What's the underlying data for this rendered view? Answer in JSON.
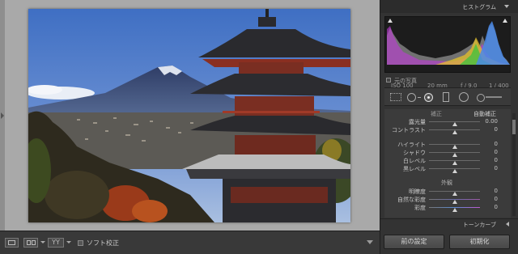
{
  "toolbar": {
    "view_glyph": "YY",
    "soft_proofing_label": "ソフト校正"
  },
  "right_panel": {
    "histogram": {
      "title": "ヒストグラム",
      "exif": {
        "iso": "ISO 100",
        "focal_length": "20 mm",
        "aperture": "f / 9.0",
        "shutter": "1 / 400"
      },
      "original_photo_label": "元の写真"
    },
    "basic": {
      "wb_label": "補正",
      "auto_tone_label": "自動補正",
      "tone_sliders": [
        {
          "label": "露光量",
          "value": "0.00",
          "position": 0.5
        },
        {
          "label": "コントラスト",
          "value": "0",
          "position": 0.5
        },
        {
          "label": "ハイライト",
          "value": "0",
          "position": 0.5
        },
        {
          "label": "シャドウ",
          "value": "0",
          "position": 0.5
        },
        {
          "label": "白レベル",
          "value": "0",
          "position": 0.5
        },
        {
          "label": "黒レベル",
          "value": "0",
          "position": 0.5
        }
      ],
      "presence_label": "外観",
      "presence_sliders": [
        {
          "label": "明瞭度",
          "value": "0",
          "position": 0.5
        },
        {
          "label": "自然な彩度",
          "value": "0",
          "position": 0.5
        },
        {
          "label": "彩度",
          "value": "0",
          "position": 0.5
        }
      ]
    },
    "tone_curve_title": "トーンカーブ",
    "buttons": {
      "previous": "前の設定",
      "reset": "初期化"
    }
  },
  "colors": {
    "workarea": "#a9a9a9",
    "panel_bg": "#333333",
    "sky": "#4d77c8",
    "pagoda_roof": "#2a2a2e",
    "pagoda_wall": "#7a2e22"
  }
}
